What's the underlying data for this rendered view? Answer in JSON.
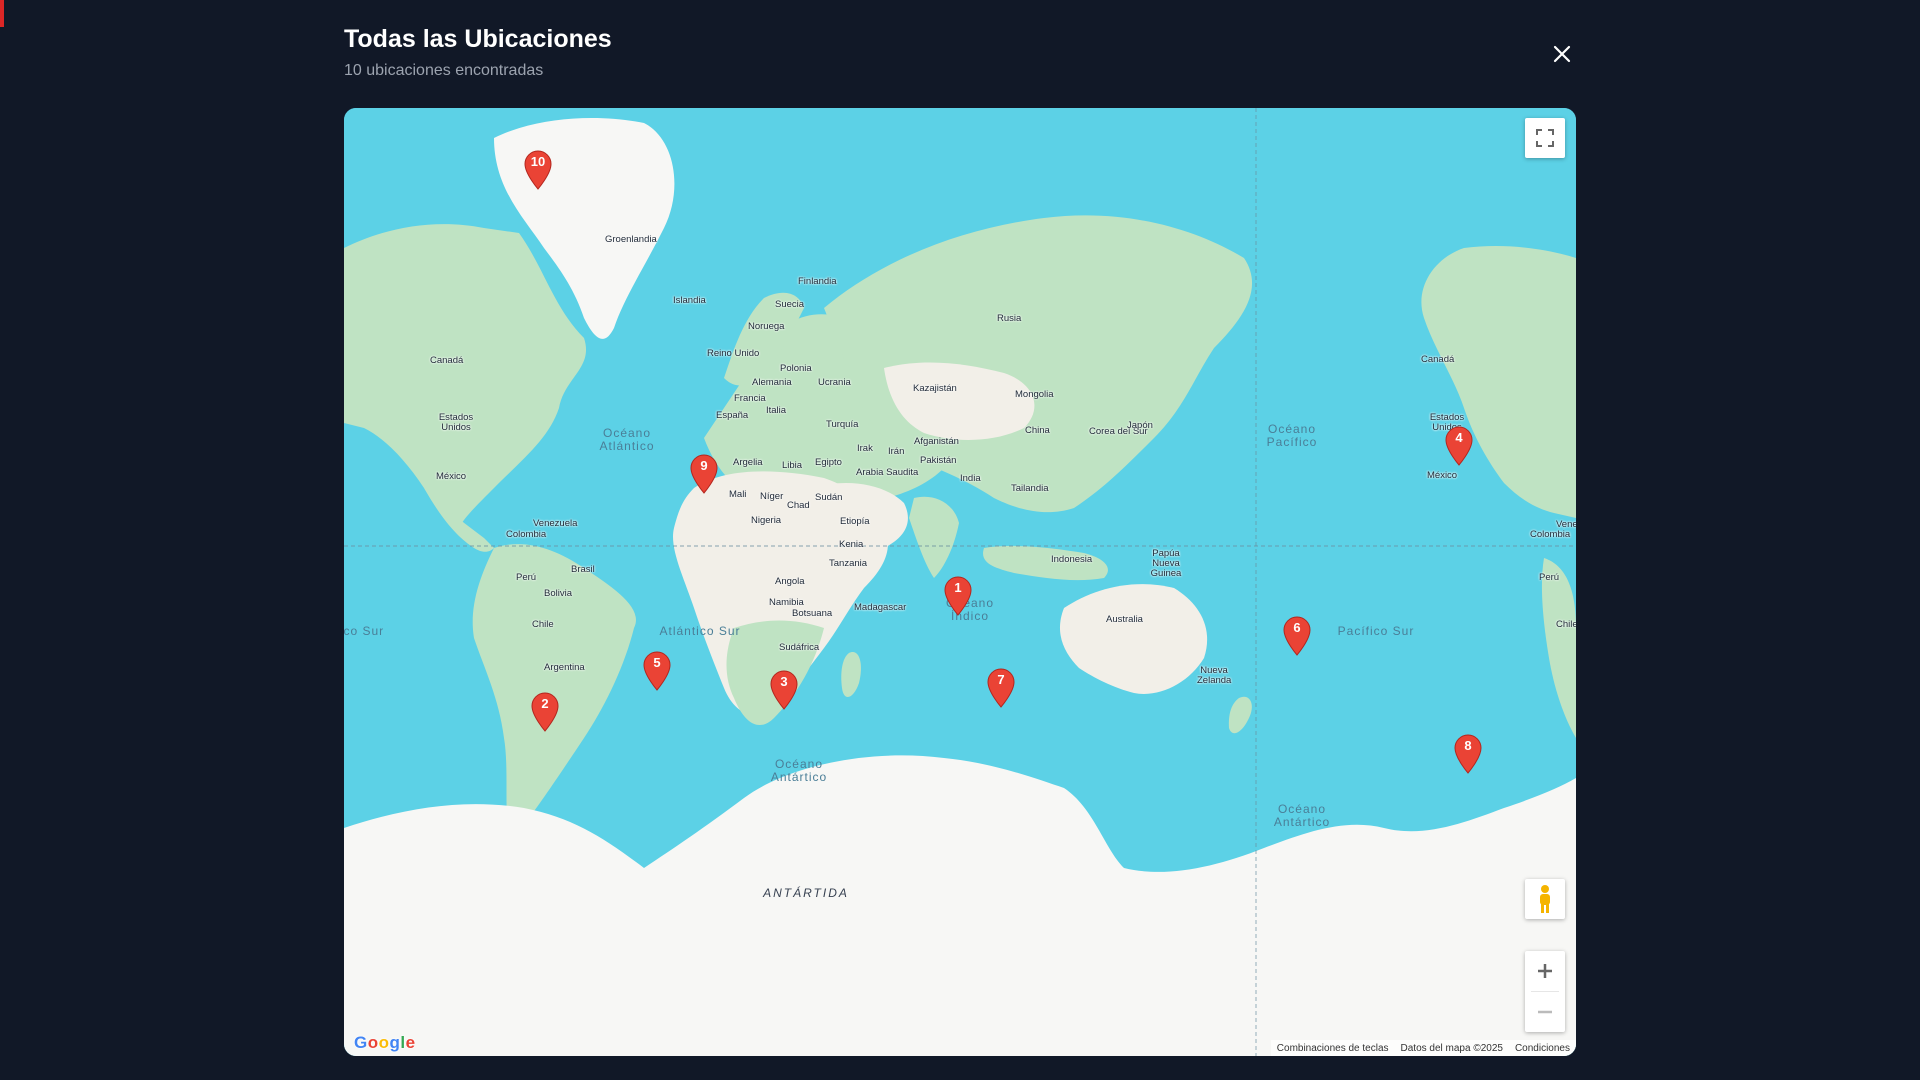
{
  "modal": {
    "title": "Todas las Ubicaciones",
    "subtitle": "10 ubicaciones encontradas",
    "close_label": "×"
  },
  "map": {
    "country_labels": [
      {
        "id": "groenlandia",
        "name": "Groenlandia"
      },
      {
        "id": "islandia",
        "name": "Islandia"
      },
      {
        "id": "finlandia",
        "name": "Finlandia"
      },
      {
        "id": "suecia",
        "name": "Suecia"
      },
      {
        "id": "noruega",
        "name": "Noruega"
      },
      {
        "id": "rusia",
        "name": "Rusia"
      },
      {
        "id": "reino-unido",
        "name": "Reino Unido"
      },
      {
        "id": "polonia",
        "name": "Polonia"
      },
      {
        "id": "alemania",
        "name": "Alemania"
      },
      {
        "id": "ucrania",
        "name": "Ucrania"
      },
      {
        "id": "francia",
        "name": "Francia"
      },
      {
        "id": "italia",
        "name": "Italia"
      },
      {
        "id": "espana",
        "name": "España"
      },
      {
        "id": "kazajistan",
        "name": "Kazajistán"
      },
      {
        "id": "mongolia",
        "name": "Mongolia"
      },
      {
        "id": "turquia",
        "name": "Turquía"
      },
      {
        "id": "china",
        "name": "China"
      },
      {
        "id": "corea-del-sur",
        "name": "Corea del Sur"
      },
      {
        "id": "japon",
        "name": "Japón"
      },
      {
        "id": "afganistan",
        "name": "Afganistán"
      },
      {
        "id": "irak",
        "name": "Irak"
      },
      {
        "id": "iran",
        "name": "Irán"
      },
      {
        "id": "pakistan",
        "name": "Pakistán"
      },
      {
        "id": "argelia",
        "name": "Argelia"
      },
      {
        "id": "libia",
        "name": "Libia"
      },
      {
        "id": "egipto",
        "name": "Egipto"
      },
      {
        "id": "arabia-saudita",
        "name": "Arabia Saudita"
      },
      {
        "id": "india",
        "name": "India"
      },
      {
        "id": "tailandia",
        "name": "Tailandia"
      },
      {
        "id": "mali",
        "name": "Mali"
      },
      {
        "id": "niger",
        "name": "Níger"
      },
      {
        "id": "chad",
        "name": "Chad"
      },
      {
        "id": "sudan",
        "name": "Sudán"
      },
      {
        "id": "nigeria",
        "name": "Nigeria"
      },
      {
        "id": "etiopia",
        "name": "Etiopía"
      },
      {
        "id": "kenia",
        "name": "Kenia"
      },
      {
        "id": "tanzania",
        "name": "Tanzania"
      },
      {
        "id": "angola",
        "name": "Angola"
      },
      {
        "id": "namibia",
        "name": "Namibia"
      },
      {
        "id": "botsuana",
        "name": "Botsuana"
      },
      {
        "id": "madagascar",
        "name": "Madagascar"
      },
      {
        "id": "sudafrica",
        "name": "Sudáfrica"
      },
      {
        "id": "indonesia",
        "name": "Indonesia"
      },
      {
        "id": "papua-nueva-guinea",
        "name": "Papúa Nueva Guinea"
      },
      {
        "id": "australia",
        "name": "Australia"
      },
      {
        "id": "nueva-zelanda",
        "name": "Nueva Zelanda"
      },
      {
        "id": "canada-west",
        "name": "Canadá"
      },
      {
        "id": "estados-unidos-west",
        "name": "Estados Unidos"
      },
      {
        "id": "mexico-west",
        "name": "México"
      },
      {
        "id": "venezuela-west",
        "name": "Venezuela"
      },
      {
        "id": "colombia-west",
        "name": "Colombia"
      },
      {
        "id": "brasil",
        "name": "Brasil"
      },
      {
        "id": "peru-west",
        "name": "Perú"
      },
      {
        "id": "bolivia",
        "name": "Bolivia"
      },
      {
        "id": "chile-west",
        "name": "Chile"
      },
      {
        "id": "argentina",
        "name": "Argentina"
      },
      {
        "id": "canada-east",
        "name": "Canadá"
      },
      {
        "id": "estados-unidos-east",
        "name": "Estados Unidos"
      },
      {
        "id": "mexico-east",
        "name": "México"
      },
      {
        "id": "venezuela-east",
        "name": "Vene"
      },
      {
        "id": "colombia-east",
        "name": "Colombia"
      },
      {
        "id": "peru-east",
        "name": "Perú"
      },
      {
        "id": "chile-east",
        "name": "Chile"
      }
    ],
    "ocean_labels": [
      {
        "id": "atlantico-norte",
        "name": "Océano\nAtlántico"
      },
      {
        "id": "pacifico-norte",
        "name": "Océano\nPacífico"
      },
      {
        "id": "atlantico-sur",
        "name": "Atlántico Sur"
      },
      {
        "id": "pacifico-sur",
        "name": "Pacífico Sur"
      },
      {
        "id": "oceano-indico",
        "name": "Océano\nÍndico"
      },
      {
        "id": "antartico-west",
        "name": "Océano\nAntártico"
      },
      {
        "id": "antartico-east",
        "name": "Océano\nAntártico"
      },
      {
        "id": "pacifico-sur-edge",
        "name": "ico Sur"
      }
    ],
    "region_label": "ANTÁRTIDA",
    "markers": [
      {
        "label": "1",
        "color": "#ea4335"
      },
      {
        "label": "2",
        "color": "#ea4335"
      },
      {
        "label": "3",
        "color": "#ea4335"
      },
      {
        "label": "4",
        "color": "#ea4335"
      },
      {
        "label": "5",
        "color": "#ea4335"
      },
      {
        "label": "6",
        "color": "#ea4335"
      },
      {
        "label": "7",
        "color": "#ea4335"
      },
      {
        "label": "8",
        "color": "#ea4335"
      },
      {
        "label": "9",
        "color": "#ea4335"
      },
      {
        "label": "10",
        "color": "#ea4335"
      }
    ],
    "colors": {
      "ocean": "#5cd1e6",
      "land": "#bfe3c3",
      "ice": "#f7f7f5",
      "desert": "#f2efe8",
      "marker": "#ea4335"
    },
    "controls": {
      "fullscreen_icon": "fullscreen-icon",
      "pegman_icon": "pegman-icon",
      "zoom_in_icon": "plus-icon",
      "zoom_out_icon": "minus-icon"
    },
    "google_logo": "Google",
    "attribution": {
      "shortcuts": "Combinaciones de teclas",
      "data": "Datos del mapa ©2025",
      "terms": "Condiciones"
    }
  }
}
